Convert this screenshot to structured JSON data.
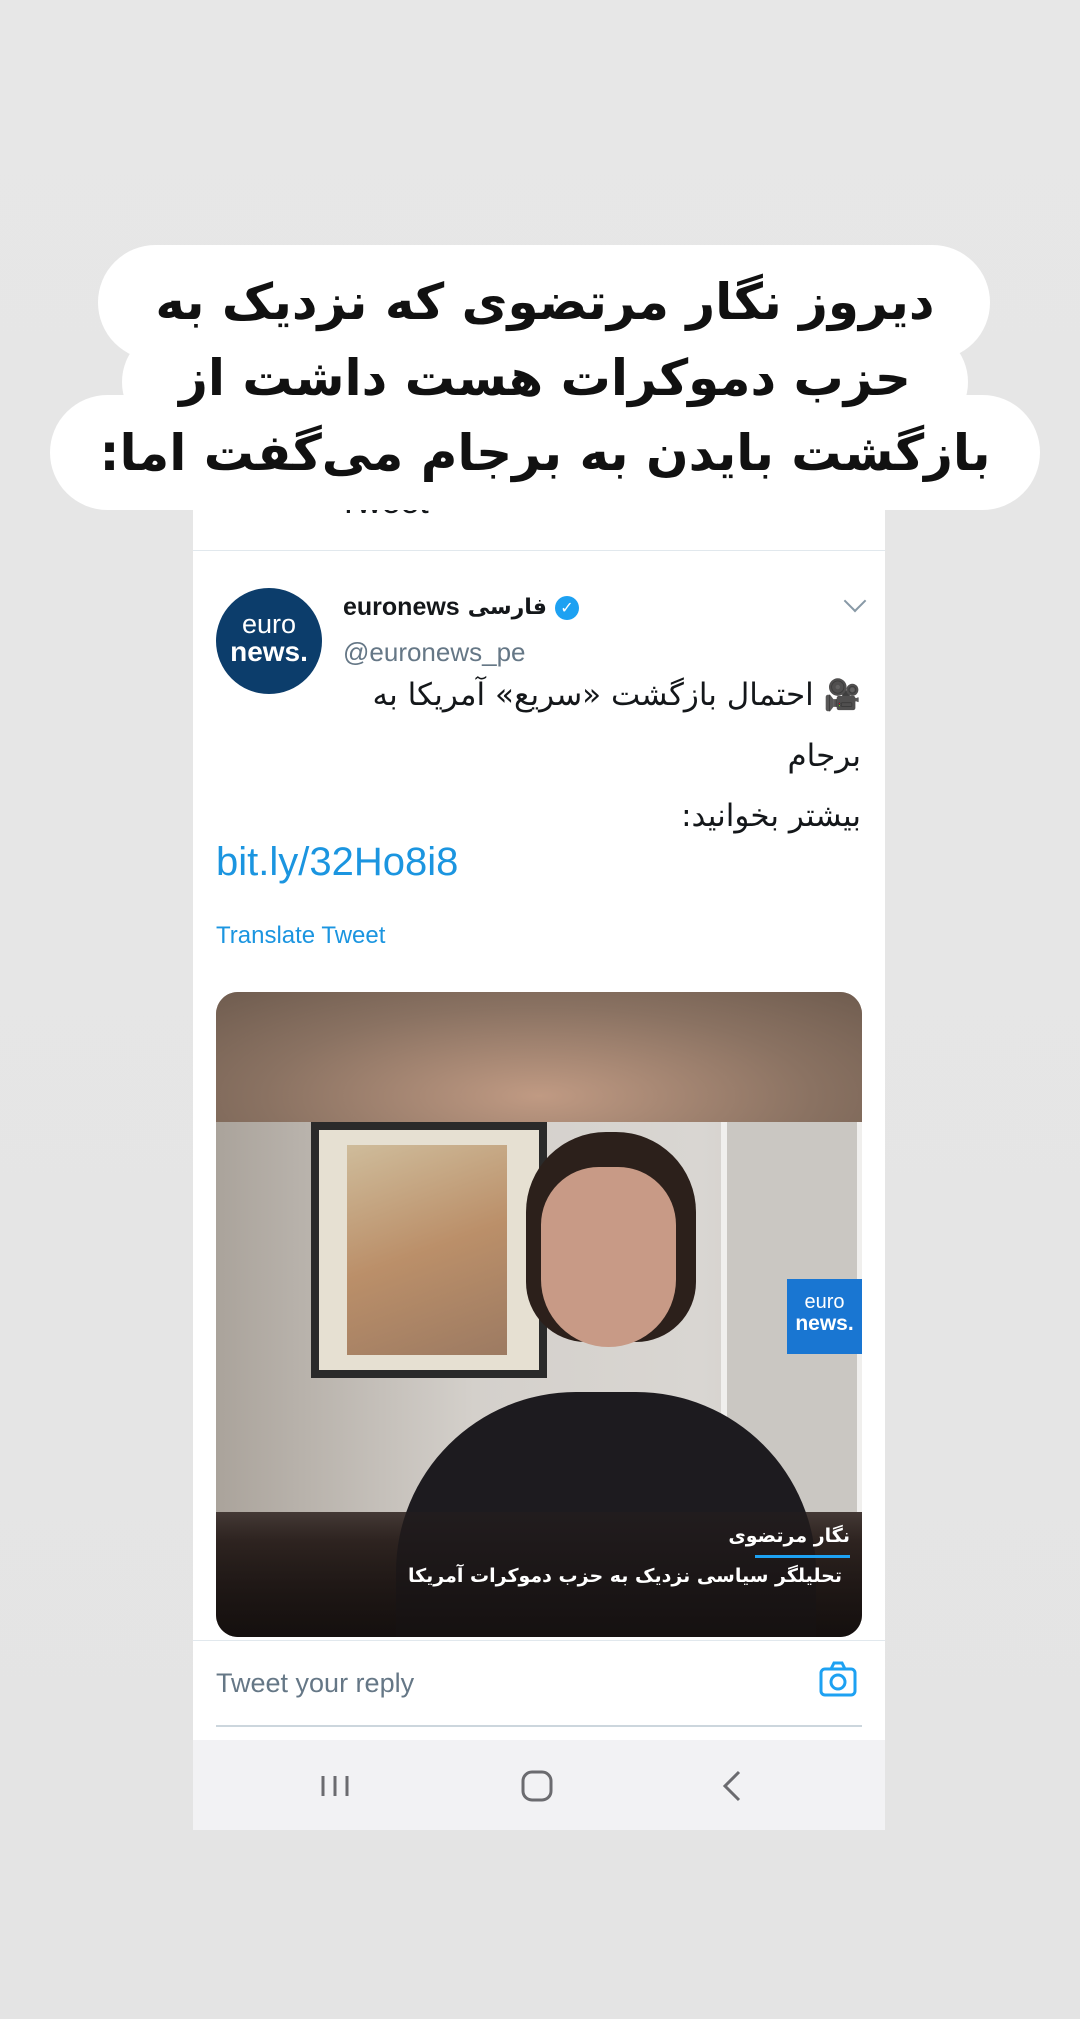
{
  "story_caption": {
    "line1": "دیروز نگار مرتضوی که نزدیک به",
    "line2": "حزب دموکرات هست داشت از",
    "line3": "بازگشت بایدن به برجام می‌گفت اما:"
  },
  "header": {
    "title": "Tweet"
  },
  "tweet": {
    "author_name": "euronews",
    "author_name_fa": "فارسی",
    "handle": "@euronews_pe",
    "avatar_line1": "euro",
    "avatar_line2": "news.",
    "text_line1": "احتمال بازگشت «سریع» آمریکا به",
    "text_line2": "برجام",
    "text_line3": "بیشتر بخوانید:",
    "emoji": "🎥",
    "link": "bit.ly/32Ho8i8",
    "translate_label": "Translate Tweet"
  },
  "video": {
    "logo_line1": "euro",
    "logo_line2": "news.",
    "lower_third_name": "نگار مرتضوی",
    "lower_third_title": "تحلیلگر سیاسی نزدیک به حزب دموکرات آمریکا"
  },
  "reply": {
    "placeholder": "Tweet your reply"
  },
  "colors": {
    "link_blue": "#1b95e0",
    "verified_blue": "#1da1f2",
    "euronews_navy": "#0c3d6b",
    "euronews_badge_blue": "#1976d2"
  },
  "icons": [
    "verified-icon",
    "chevron-down-icon",
    "camera-icon",
    "recent-apps-icon",
    "home-icon",
    "back-icon"
  ]
}
